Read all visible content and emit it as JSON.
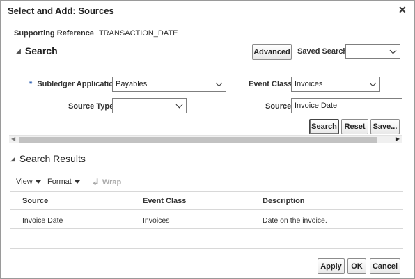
{
  "dialog": {
    "title": "Select and Add: Sources",
    "close_symbol": "✕"
  },
  "supporting_reference": {
    "label": "Supporting Reference",
    "value": "TRANSACTION_DATE"
  },
  "search": {
    "header": "Search",
    "advanced_label": "Advanced",
    "saved_search_label": "Saved Search",
    "saved_search_value": "",
    "fields": {
      "required_marker": "*",
      "subledger_application_label": "Subledger Application",
      "subledger_application_value": "Payables",
      "event_class_label": "Event Class",
      "event_class_value": "Invoices",
      "source_type_label": "Source Type",
      "source_type_value": "",
      "source_label": "Source",
      "source_value": "Invoice Date"
    },
    "buttons": {
      "search": "Search",
      "reset": "Reset",
      "save": "Save..."
    }
  },
  "results": {
    "header": "Search Results",
    "toolbar": {
      "view": "View",
      "format": "Format",
      "wrap": "Wrap"
    },
    "columns": [
      "Source",
      "Event Class",
      "Description"
    ],
    "rows": [
      [
        "Invoice Date",
        "Invoices",
        "Date on the invoice."
      ]
    ]
  },
  "footer": {
    "apply": "Apply",
    "ok": "OK",
    "cancel": "Cancel"
  },
  "icons": {
    "collapse": "triangle-collapse-icon",
    "wrap": "wrap-icon",
    "dropdown": "chevron-down-icon"
  }
}
